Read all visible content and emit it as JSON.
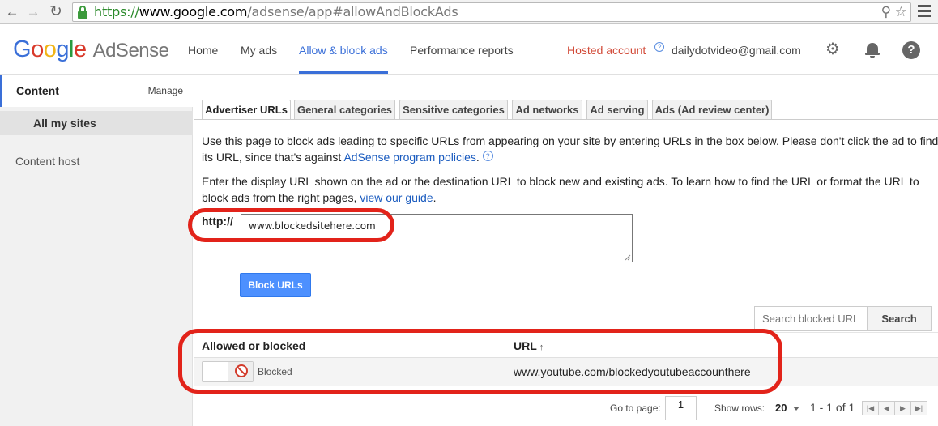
{
  "browser": {
    "url_protocol": "https://",
    "url_host": "www.google.com",
    "url_path": "/adsense/app#allowAndBlockAds",
    "icons": [
      "back-arrow-icon",
      "forward-arrow-icon",
      "reload-icon",
      "lock-icon",
      "zoom-icon",
      "star-icon",
      "menu-icon"
    ]
  },
  "header": {
    "logo_google": [
      "G",
      "o",
      "o",
      "g",
      "l",
      "e"
    ],
    "logo_product": "AdSense",
    "nav": [
      "Home",
      "My ads",
      "Allow & block ads",
      "Performance reports"
    ],
    "active_nav": "Allow & block ads",
    "hosted_account": "Hosted account",
    "account_email": "dailydotvideo@gmail.com",
    "help_mark": "?"
  },
  "sidebar": {
    "section_title": "Content",
    "manage_link": "Manage",
    "items": [
      "All my sites",
      "Content host"
    ]
  },
  "tabs": [
    "Advertiser URLs",
    "General categories",
    "Sensitive categories",
    "Ad networks",
    "Ad serving",
    "Ads (Ad review center)"
  ],
  "intro": {
    "p1_text": "Use this page to block ads leading to specific URLs from appearing on your site by entering URLs in the box below. Please don't click the ad to find its URL, since that's against ",
    "p1_link": "AdSense program policies",
    "p1_end": ".",
    "p2_text": "Enter the display URL shown on the ad or the destination URL to block new and existing ads. To learn how to find the URL or format the URL to block ads from the right pages, ",
    "p2_link": "view our guide",
    "p2_end": "."
  },
  "block_form": {
    "prefix_label": "http://",
    "textarea_value": "www.blockedsitehere.com",
    "button_label": "Block URLs"
  },
  "search": {
    "placeholder": "Search blocked URLs",
    "button_label": "Search"
  },
  "table": {
    "columns": [
      "Allowed or blocked",
      "URL"
    ],
    "sort_indicator": "↑",
    "rows": [
      {
        "status": "Blocked",
        "url": "www.youtube.com/blockedyoutubeaccounthere"
      }
    ]
  },
  "pagination": {
    "go_to_label": "Go to page:",
    "page_value": "1",
    "rows_label": "Show rows:",
    "rows_value": "20",
    "range_text": "1 - 1 of 1"
  },
  "colors": {
    "accent": "#3a6fd8",
    "highlight_oval": "#e2231a",
    "hosted_account": "#d14836",
    "primary_button": "#4d90fe"
  }
}
